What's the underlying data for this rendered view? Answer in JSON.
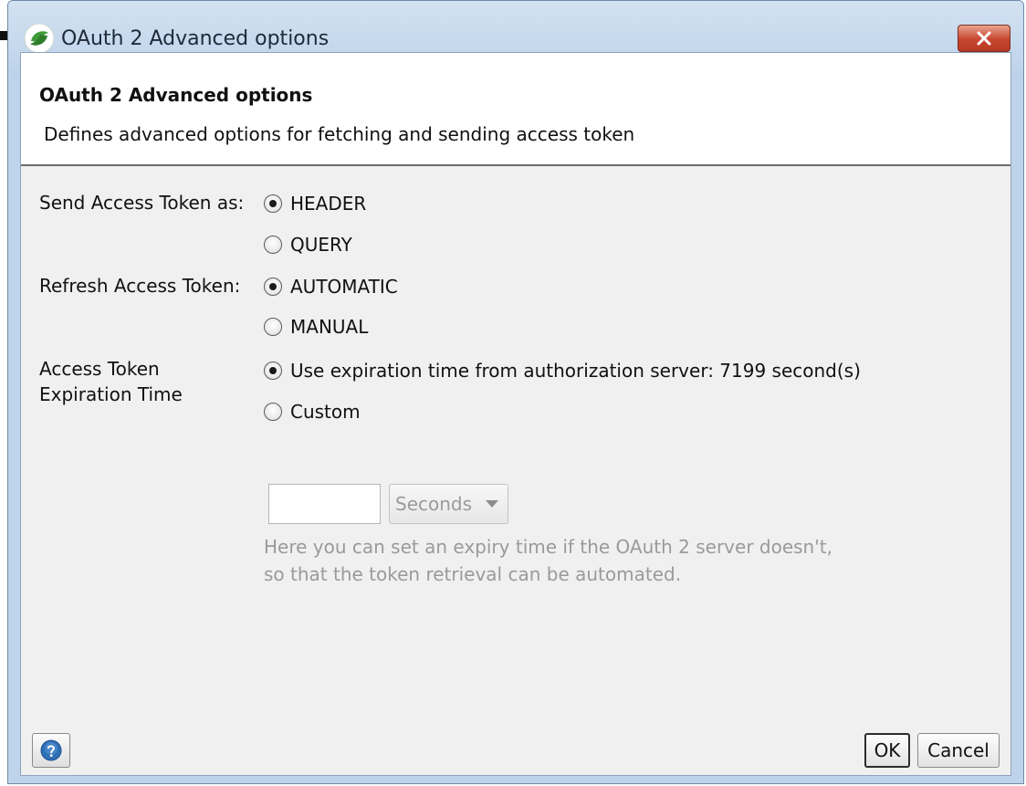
{
  "window": {
    "title": "OAuth 2 Advanced options"
  },
  "header": {
    "title": "OAuth 2 Advanced options",
    "description": "Defines advanced options for fetching and sending access token"
  },
  "send_token": {
    "label": "Send Access Token as:",
    "options": [
      {
        "label": "HEADER",
        "selected": true
      },
      {
        "label": "QUERY",
        "selected": false
      }
    ]
  },
  "refresh_token": {
    "label": "Refresh Access Token:",
    "options": [
      {
        "label": "AUTOMATIC",
        "selected": true
      },
      {
        "label": "MANUAL",
        "selected": false
      }
    ]
  },
  "expiration": {
    "label_line1": "Access Token",
    "label_line2": "Expiration Time",
    "options": [
      {
        "label": "Use expiration time from authorization server: 7199 second(s)",
        "selected": true
      },
      {
        "label": "Custom",
        "selected": false
      }
    ],
    "custom_value": "",
    "unit_selected": "Seconds",
    "hint_line1": "Here you can set an expiry time if the OAuth 2 server doesn't,",
    "hint_line2": "so that the token retrieval can be automated."
  },
  "footer": {
    "ok_label": "OK",
    "cancel_label": "Cancel"
  },
  "icons": {
    "app": "soapui-logo-icon",
    "close": "close-icon",
    "help": "help-icon"
  },
  "colors": {
    "title_bar": "#bfd3ea",
    "close_button": "#c7452d",
    "hint_text": "#9a9a9a",
    "help_icon": "#2f6fb5"
  }
}
